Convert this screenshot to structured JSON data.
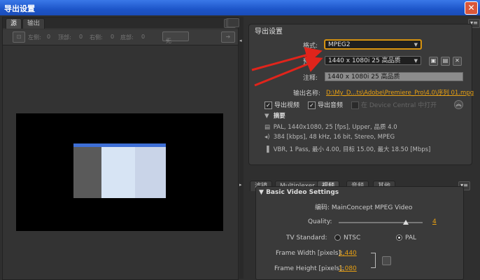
{
  "window": {
    "title": "导出设置",
    "close_glyph": "✕"
  },
  "left": {
    "tabs": [
      {
        "label": "源",
        "active": true
      },
      {
        "label": "输出",
        "active": false
      }
    ],
    "crop_labels": [
      "左侧:",
      "0",
      "顶部:",
      "0",
      "右侧:",
      "0",
      "底部:",
      "0"
    ],
    "aspect_select": "无",
    "menu_glyph": "▾≡"
  },
  "export": {
    "section_title": "导出设置",
    "format_label": "格式:",
    "format_value": "MPEG2",
    "preset_label": "预置:",
    "preset_value": "1440 x 1080i 25 高品质",
    "comment_label": "注释:",
    "comment_value": "1440 x 1080i 25 高品质",
    "output_name_label": "输出名称:",
    "output_name_value": "D:\\My_D...ts\\Adobe\\Premiere_Pro\\4.0\\序列 01.mpg",
    "export_video": "导出视频",
    "export_audio": "导出音频",
    "device_central": "在 Device Central 中打开",
    "summary_title": "摘要",
    "summary_lines": [
      "PAL, 1440x1080, 25 [fps], Upper, 品质 4.0",
      "384 [kbps], 48 kHz, 16 bit, Stereo, MPEG",
      "VBR, 1 Pass, 最小 4.00, 目标 15.00, 最大 18.50 [Mbps]"
    ]
  },
  "right_tabs": [
    {
      "label": "滤镜",
      "active": false
    },
    {
      "label": "Multiplexer",
      "active": false
    },
    {
      "label": "视频",
      "active": true
    },
    {
      "label": "音频",
      "active": false
    },
    {
      "label": "其他",
      "active": false
    }
  ],
  "video": {
    "panel_title": "Basic Video Settings",
    "codec_label": "编码: MainConcept MPEG Video",
    "quality_label": "Quality:",
    "quality_value": "4",
    "quality_fraction": 0.8,
    "tv_label": "TV Standard:",
    "ntsc": "NTSC",
    "pal": "PAL",
    "selected": "PAL",
    "fw_label": "Frame Width [pixels]:",
    "fw_value": "1,440",
    "fh_label": "Frame Height [pixels]:",
    "fh_value": "1,080"
  },
  "colors": {
    "accent": "#e8a012",
    "title_bar": "#1d55c9",
    "arrow": "#e0241b"
  }
}
